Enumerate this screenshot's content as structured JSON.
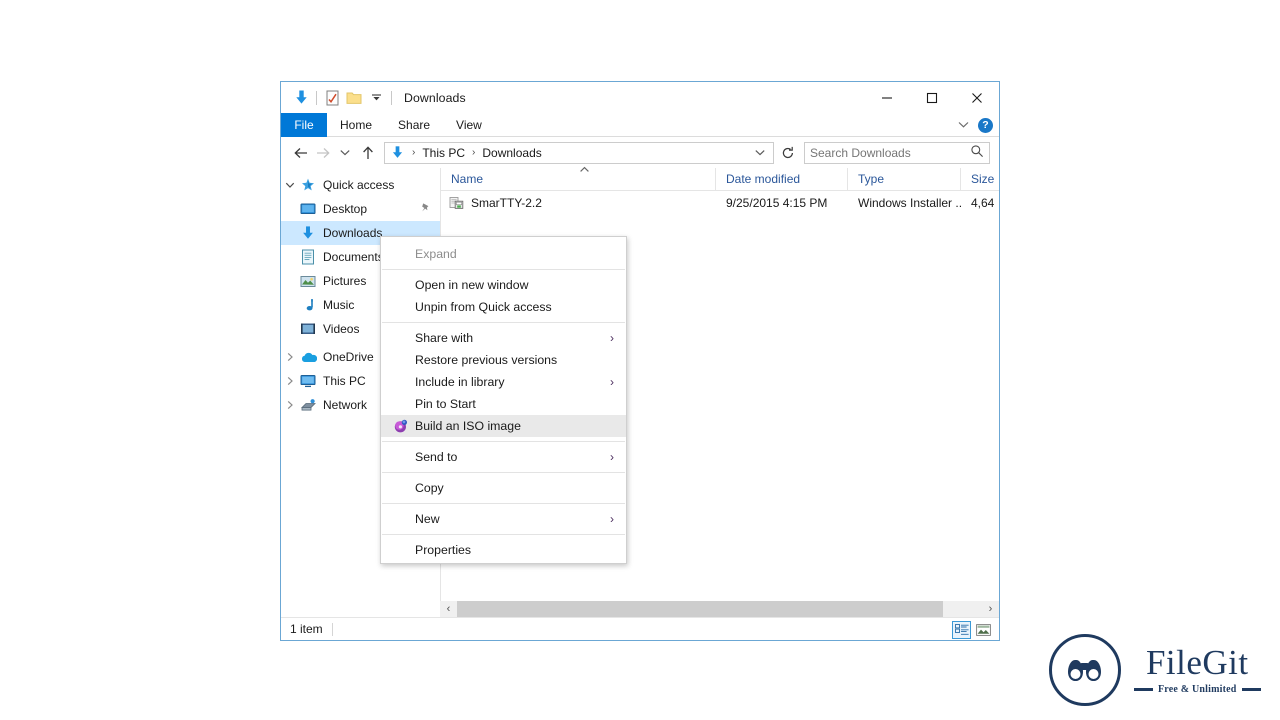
{
  "window": {
    "title": "Downloads",
    "quick_access_toolbar": [
      {
        "name": "downloads-folder-icon",
        "label": "Downloads"
      },
      {
        "name": "properties-icon",
        "label": "Properties"
      },
      {
        "name": "new-folder-icon",
        "label": "New folder"
      },
      {
        "name": "customize-qat-chevron-icon",
        "label": "Customize Quick Access Toolbar"
      }
    ],
    "controls": {
      "minimize": "Minimize",
      "maximize": "Maximize",
      "close": "Close"
    }
  },
  "ribbon": {
    "tabs": [
      {
        "label": "File",
        "active": true
      },
      {
        "label": "Home",
        "active": false
      },
      {
        "label": "Share",
        "active": false
      },
      {
        "label": "View",
        "active": false
      }
    ],
    "expand_label": "Expand the Ribbon",
    "help_label": "?"
  },
  "navbar": {
    "back": "Back",
    "forward": "Forward",
    "recent": "Recent locations",
    "up": "Up",
    "breadcrumbs": [
      "This PC",
      "Downloads"
    ],
    "breadcrumb_separator": "›",
    "refresh": "Refresh",
    "search_placeholder": "Search Downloads",
    "search_value": ""
  },
  "sidebar": {
    "items": [
      {
        "label": "Quick access",
        "level": 0,
        "icon": "star-pin-icon",
        "expanded": true,
        "chevron": "expanded",
        "selected": false,
        "pinned": false
      },
      {
        "label": "Desktop",
        "level": 1,
        "icon": "desktop-icon",
        "selected": false,
        "pinned": true
      },
      {
        "label": "Downloads",
        "level": 1,
        "icon": "downloads-arrow-icon",
        "selected": true,
        "pinned": false
      },
      {
        "label": "Documents",
        "level": 1,
        "icon": "documents-icon",
        "selected": false,
        "pinned": false
      },
      {
        "label": "Pictures",
        "level": 1,
        "icon": "pictures-icon",
        "selected": false,
        "pinned": false
      },
      {
        "label": "Music",
        "level": 1,
        "icon": "music-note-icon",
        "selected": false,
        "pinned": false
      },
      {
        "label": "Videos",
        "level": 1,
        "icon": "videos-icon",
        "selected": false,
        "pinned": false
      },
      {
        "label": "OneDrive",
        "level": 0,
        "icon": "onedrive-cloud-icon",
        "chevron": "collapsed",
        "selected": false,
        "pinned": false
      },
      {
        "label": "This PC",
        "level": 0,
        "icon": "this-pc-icon",
        "chevron": "collapsed",
        "selected": false,
        "pinned": false
      },
      {
        "label": "Network",
        "level": 0,
        "icon": "network-icon",
        "chevron": "collapsed",
        "selected": false,
        "pinned": false
      }
    ]
  },
  "filelist": {
    "columns": [
      {
        "label": "Name",
        "sorted": "ascending"
      },
      {
        "label": "Date modified",
        "sorted": ""
      },
      {
        "label": "Type",
        "sorted": ""
      },
      {
        "label": "Size",
        "sorted": ""
      }
    ],
    "rows": [
      {
        "name": "SmarTTY-2.2",
        "icon": "windows-installer-icon",
        "date_modified": "9/25/2015 4:15 PM",
        "type": "Windows Installer ...",
        "size": "4,64"
      }
    ]
  },
  "scrollbar": {
    "left_arrow": "‹",
    "right_arrow": "›"
  },
  "statusbar": {
    "item_count": "1 item",
    "views": [
      {
        "name": "details-view-button",
        "label": "Details view",
        "active": true
      },
      {
        "name": "large-icons-view-button",
        "label": "Large icons view",
        "active": false
      }
    ]
  },
  "context_menu": {
    "items": [
      {
        "label": "Expand",
        "disabled": true,
        "submenu": false,
        "icon": "",
        "highlight": false
      },
      {
        "separator": true
      },
      {
        "label": "Open in new window",
        "disabled": false,
        "submenu": false,
        "icon": "",
        "highlight": false
      },
      {
        "label": "Unpin from Quick access",
        "disabled": false,
        "submenu": false,
        "icon": "",
        "highlight": false
      },
      {
        "separator": true
      },
      {
        "label": "Share with",
        "disabled": false,
        "submenu": true,
        "icon": "",
        "highlight": false
      },
      {
        "label": "Restore previous versions",
        "disabled": false,
        "submenu": false,
        "icon": "",
        "highlight": false
      },
      {
        "label": "Include in library",
        "disabled": false,
        "submenu": true,
        "icon": "",
        "highlight": false
      },
      {
        "label": "Pin to Start",
        "disabled": false,
        "submenu": false,
        "icon": "",
        "highlight": false
      },
      {
        "label": "Build an ISO image",
        "disabled": false,
        "submenu": false,
        "icon": "iso-disc-icon",
        "highlight": true
      },
      {
        "separator": true
      },
      {
        "label": "Send to",
        "disabled": false,
        "submenu": true,
        "icon": "",
        "highlight": false
      },
      {
        "separator": true
      },
      {
        "label": "Copy",
        "disabled": false,
        "submenu": false,
        "icon": "",
        "highlight": false
      },
      {
        "separator": true
      },
      {
        "label": "New",
        "disabled": false,
        "submenu": true,
        "icon": "",
        "highlight": false
      },
      {
        "separator": true
      },
      {
        "label": "Properties",
        "disabled": false,
        "submenu": false,
        "icon": "",
        "highlight": false
      }
    ],
    "submenu_arrow": "›"
  },
  "watermark": {
    "brand": "FileGit",
    "tagline": "Free & Unlimited",
    "icon": "binoculars-icon"
  },
  "colors": {
    "accent": "#0078d7",
    "selection": "#cce8ff",
    "brand": "#1f3a5f",
    "window_border": "#6ba7d4",
    "menu_highlight": "#e9e9e9"
  }
}
